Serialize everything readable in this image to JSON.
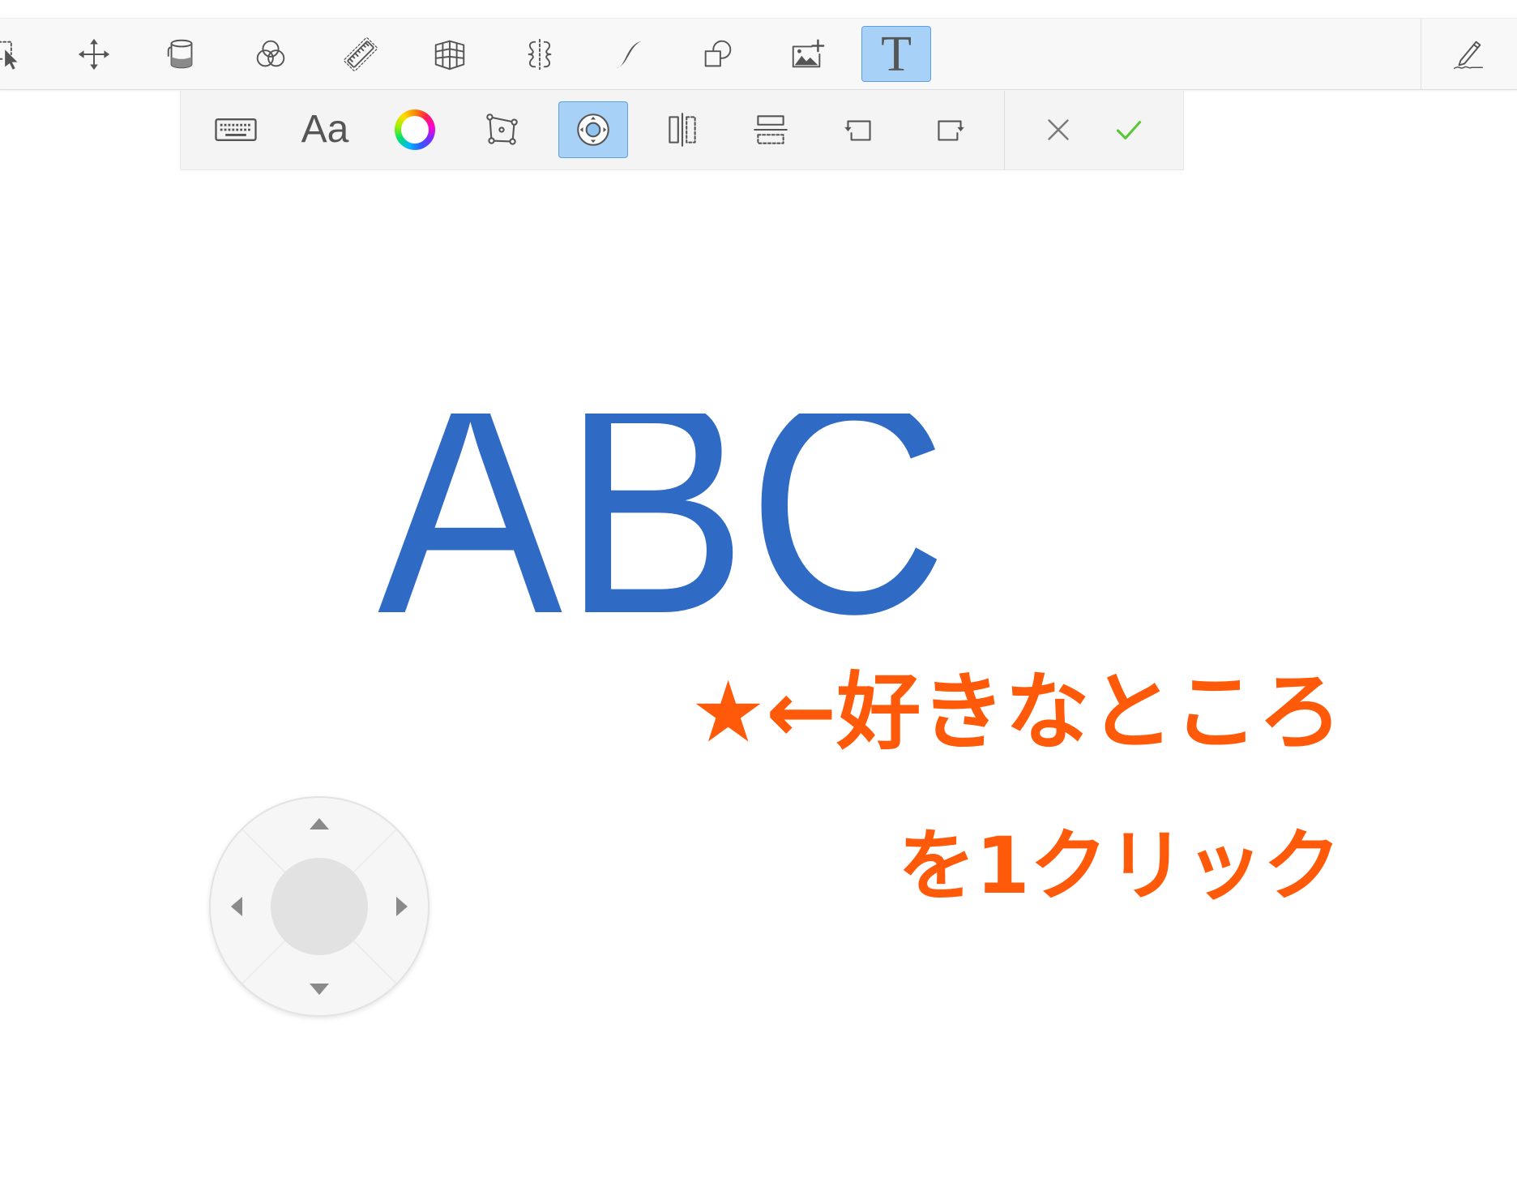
{
  "main_toolbar": {
    "tool_icons": [
      "selection-icon",
      "move-icon",
      "fill-bucket-icon",
      "blend-icon",
      "ruler-icon",
      "perspective-grid-icon",
      "symmetry-icon",
      "stroke-icon",
      "shapes-icon",
      "insert-image-icon",
      "text-tool-icon"
    ],
    "active_tool_icon": "text-tool-icon",
    "text_tool_glyph": "T",
    "right_tool_icon": "pen-signature-icon"
  },
  "text_toolbar": {
    "item_icons": [
      "keyboard-icon",
      "font-icon",
      "color-wheel-icon",
      "distort-icon",
      "nudge-icon",
      "flip-horizontal-icon",
      "flip-vertical-icon",
      "rotate-left-icon",
      "rotate-right-icon"
    ],
    "font_glyph": "Aa",
    "active_item_icon": "nudge-icon",
    "action_icons": [
      "close-icon",
      "check-icon"
    ]
  },
  "canvas": {
    "text": "ABC",
    "annotation_line1": "★←好きなところ",
    "annotation_line2": "を1クリック"
  },
  "nudge_pad": {
    "icons": [
      "arrow-up-icon",
      "arrow-down-icon",
      "arrow-left-icon",
      "arrow-right-icon"
    ]
  },
  "colors": {
    "accent": "#a8d1f7",
    "accent_border": "#5aa0e6",
    "icon": "#555555",
    "text_color": "#2f6bc5",
    "annotation": "#ff5a0a",
    "confirm": "#5cc638",
    "toolbar_bg": "#f8f8f8",
    "subtoolbar_bg": "#f4f4f4"
  }
}
